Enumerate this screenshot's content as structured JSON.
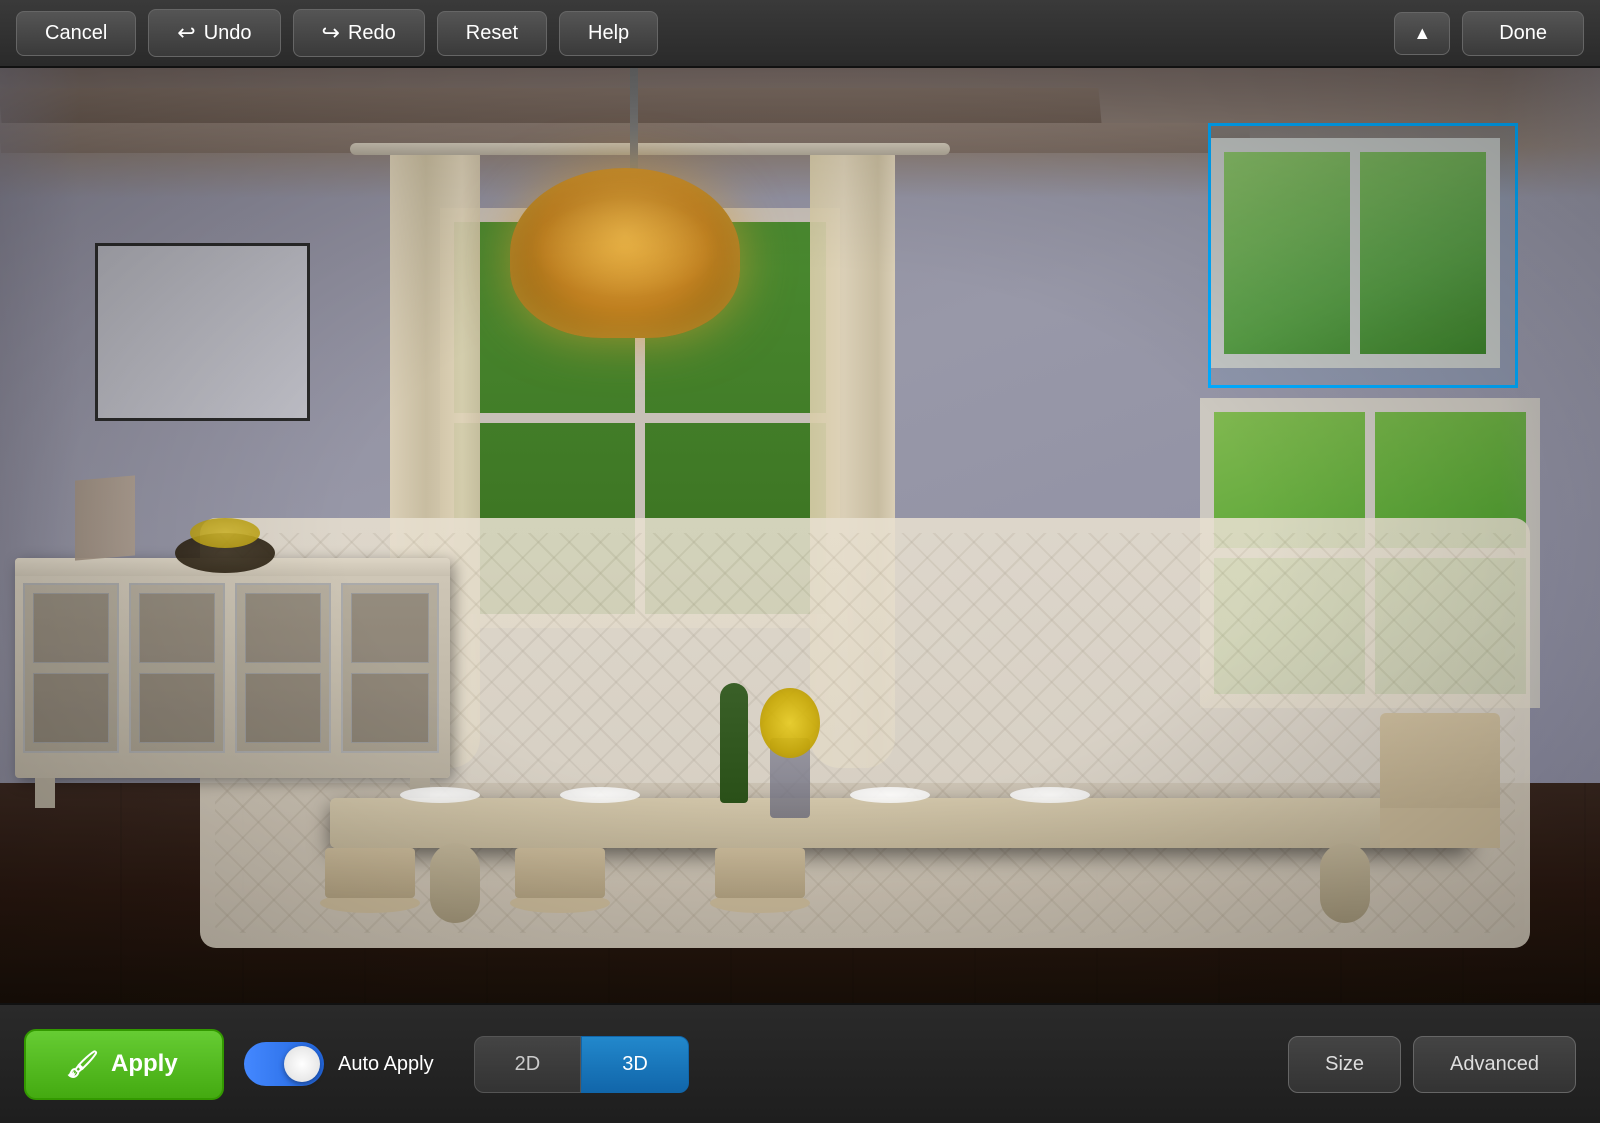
{
  "toolbar": {
    "cancel_label": "Cancel",
    "undo_label": "Undo",
    "redo_label": "Redo",
    "reset_label": "Reset",
    "help_label": "Help",
    "done_label": "Done",
    "collapse_icon": "▲"
  },
  "bottom_bar": {
    "apply_label": "Apply",
    "auto_apply_label": "Auto Apply",
    "view_2d_label": "2D",
    "view_3d_label": "3D",
    "size_label": "Size",
    "advanced_label": "Advanced",
    "paint_icon": "🎨",
    "toggle_on": true
  },
  "scene": {
    "selection_visible": true
  }
}
